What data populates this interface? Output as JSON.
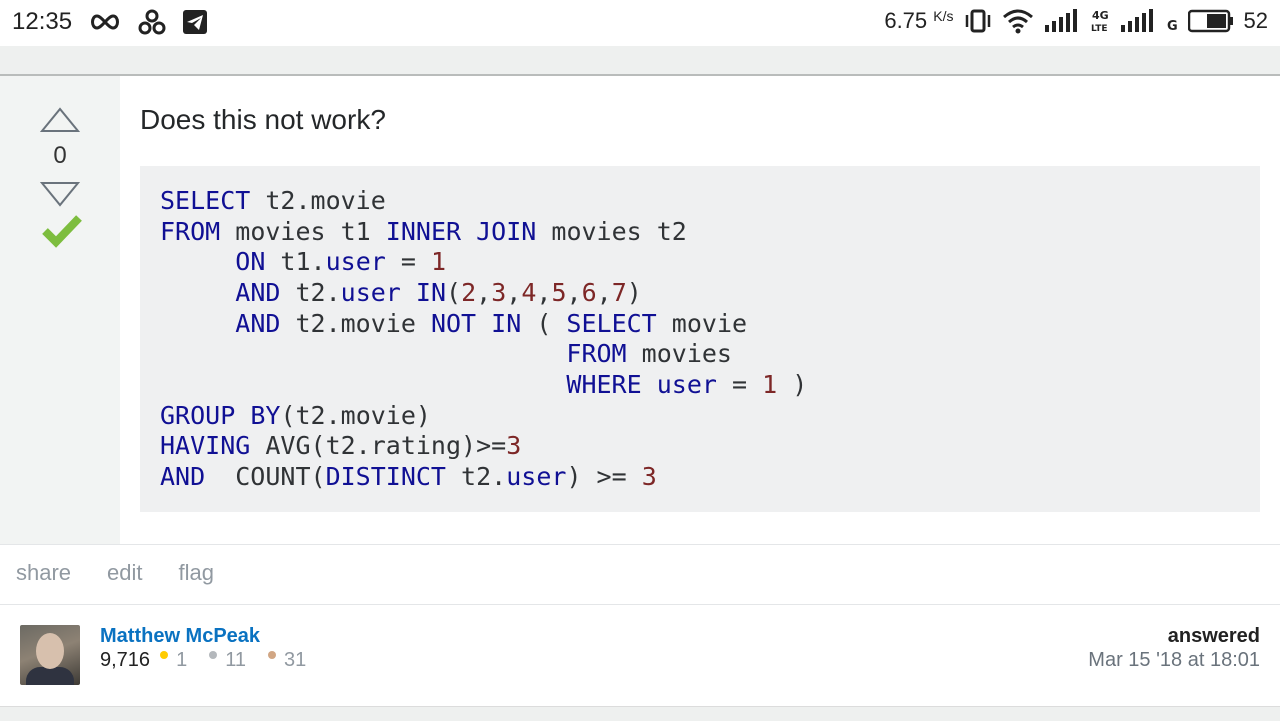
{
  "status_bar": {
    "time": "12:35",
    "left_icons": [
      "infinity-icon",
      "pinwheel-icon",
      "telegram-icon"
    ],
    "speed_value": "6.75",
    "speed_unit": "K/s",
    "right_icons": [
      "vibrate-icon",
      "wifi-icon",
      "signal-icon",
      "4g-lte-icon",
      "signal-icon",
      "g-icon",
      "battery-icon"
    ],
    "battery_percent": "52"
  },
  "answer": {
    "vote_count": "0",
    "accepted": true,
    "text": "Does this not work?",
    "code_lines": [
      "SELECT t2.movie",
      "FROM movies t1 INNER JOIN movies t2",
      "     ON t1.user = 1",
      "     AND t2.user IN(2,3,4,5,6,7)",
      "     AND t2.movie NOT IN ( SELECT movie",
      "                           FROM movies",
      "                           WHERE user = 1 )",
      "GROUP BY(t2.movie)",
      "HAVING AVG(t2.rating)>=3",
      "AND  COUNT(DISTINCT t2.user) >= 3"
    ]
  },
  "actions": {
    "share": "share",
    "edit": "edit",
    "flag": "flag"
  },
  "user": {
    "name": "Matthew McPeak",
    "reputation": "9,716",
    "gold": "1",
    "silver": "11",
    "bronze": "31",
    "answered_label": "answered",
    "answered_time": "Mar 15 '18 at 18:01"
  },
  "colors": {
    "accent": "#0a72c1",
    "accepted": "#7dbd3e",
    "gold": "#ffcc01",
    "silver": "#b4b8bc",
    "bronze": "#d1a684"
  }
}
